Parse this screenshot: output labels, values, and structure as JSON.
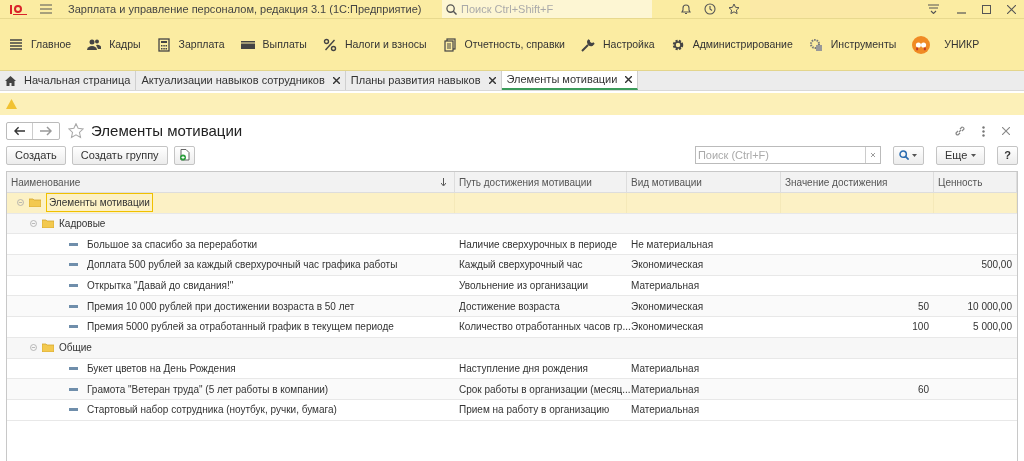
{
  "window": {
    "title": "Зарплата и управление персоналом, редакция 3.1  (1С:Предприятие)",
    "search_placeholder": "Поиск Ctrl+Shift+F"
  },
  "sections": [
    {
      "label": "Главное"
    },
    {
      "label": "Кадры"
    },
    {
      "label": "Зарплата"
    },
    {
      "label": "Выплаты"
    },
    {
      "label": "Налоги и взносы"
    },
    {
      "label": "Отчетность, справки"
    },
    {
      "label": "Настройка"
    },
    {
      "label": "Администрирование"
    },
    {
      "label": "Инструменты"
    },
    {
      "label": "УНИКР"
    }
  ],
  "tabs": [
    {
      "label": "Начальная страница",
      "home": true,
      "closable": false,
      "selected": false
    },
    {
      "label": "Актуализации навыков сотрудников",
      "home": false,
      "closable": true,
      "selected": false
    },
    {
      "label": "Планы развития навыков",
      "home": false,
      "closable": true,
      "selected": false
    },
    {
      "label": "Элементы мотивации",
      "home": false,
      "closable": true,
      "selected": true
    }
  ],
  "form": {
    "title": "Элементы мотивации",
    "buttons": [
      "Создать",
      "Создать группу"
    ],
    "search_placeholder": "Поиск (Ctrl+F)",
    "more": "Еще",
    "help": "?"
  },
  "table": {
    "columns": [
      "Наименование",
      "Путь достижения мотивации",
      "Вид мотивации",
      "Значение достижения",
      "Ценность"
    ],
    "rows": [
      {
        "name": "Элементы мотивации",
        "kind": "group",
        "selected": true,
        "children": [
          {
            "name": "Кадровые",
            "kind": "group",
            "selected": false,
            "children": [
              {
                "name": "Большое за спасибо за переработки",
                "kind": "item",
                "selected": false,
                "path": "Наличие сверхурочных в периоде",
                "type": "Не материальная"
              },
              {
                "name": "Доплата 500 рублей за каждый сверхурочный час графика работы",
                "kind": "item",
                "selected": false,
                "path": "Каждый сверхурочный час",
                "type": "Экономическая",
                "worth": "500,00"
              },
              {
                "name": "Открытка \"Давай до свидания!\"",
                "kind": "item",
                "selected": false,
                "path": "Увольнение из организации",
                "type": "Материальная"
              },
              {
                "name": "Премия 10 000 рублей при достижении возраста в 50 лет",
                "kind": "item",
                "selected": false,
                "path": "Достижение возраста",
                "type": "Экономическая",
                "value": "50",
                "worth": "10 000,00"
              },
              {
                "name": "Премия 5000 рублей за отработанный график в текущем периоде",
                "kind": "item",
                "selected": false,
                "path": "Количество отработанных часов гр...",
                "type": "Экономическая",
                "value": "100",
                "worth": "5 000,00"
              }
            ]
          },
          {
            "name": "Общие",
            "kind": "group",
            "selected": false,
            "children": [
              {
                "name": "Букет цветов на День Рождения",
                "kind": "item",
                "selected": false,
                "path": "Наступление дня рождения",
                "type": "Материальная"
              },
              {
                "name": "Грамота \"Ветеран труда\" (5 лет работы в компании)",
                "kind": "item",
                "selected": false,
                "path": "Срок работы в организации (месяц...",
                "type": "Материальная",
                "value": "60"
              },
              {
                "name": "Стартовый набор сотрудника (ноутбук, ручки, бумага)",
                "kind": "item",
                "selected": false,
                "path": "Прием на работу в организацию",
                "type": "Материальная"
              }
            ]
          }
        ]
      }
    ]
  }
}
